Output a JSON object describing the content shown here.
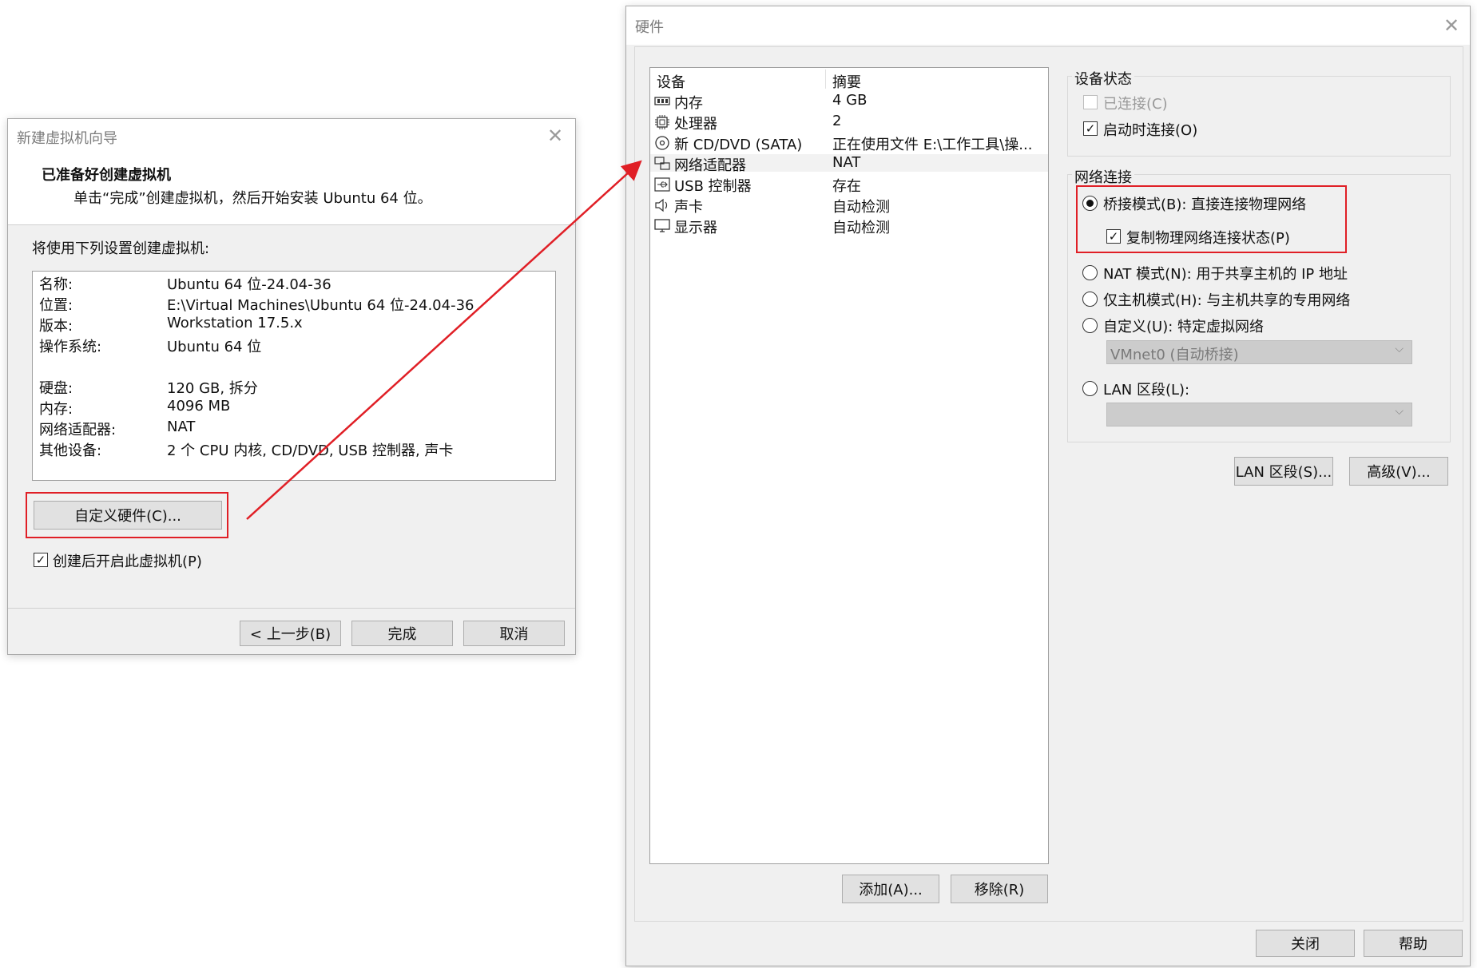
{
  "wizard": {
    "title": "新建虚拟机向导",
    "heading": "已准备好创建虚拟机",
    "subheading": "单击“完成”创建虚拟机，然后开始安装 Ubuntu 64 位。",
    "intro": "将使用下列设置创建虚拟机:",
    "settings": [
      {
        "label": "名称:",
        "value": "Ubuntu 64 位-24.04-36"
      },
      {
        "label": "位置:",
        "value": "E:\\Virtual Machines\\Ubuntu 64 位-24.04-36"
      },
      {
        "label": "版本:",
        "value": "Workstation 17.5.x"
      },
      {
        "label": "操作系统:",
        "value": "Ubuntu 64 位"
      },
      {
        "label": "硬盘:",
        "value": "120 GB, 拆分"
      },
      {
        "label": "内存:",
        "value": "4096 MB"
      },
      {
        "label": "网络适配器:",
        "value": "NAT"
      },
      {
        "label": "其他设备:",
        "value": "2 个 CPU 内核, CD/DVD, USB 控制器, 声卡"
      }
    ],
    "customize_button": "自定义硬件(C)...",
    "poweron_checkbox": "创建后开启此虚拟机(P)",
    "back_button": "< 上一步(B)",
    "finish_button": "完成",
    "cancel_button": "取消"
  },
  "hardware": {
    "title": "硬件",
    "col_device": "设备",
    "col_summary": "摘要",
    "devices": [
      {
        "icon": "memory-icon",
        "name": "内存",
        "summary": "4 GB"
      },
      {
        "icon": "cpu-icon",
        "name": "处理器",
        "summary": "2"
      },
      {
        "icon": "cd-icon",
        "name": "新 CD/DVD (SATA)",
        "summary": "正在使用文件 E:\\工作工具\\操..."
      },
      {
        "icon": "network-icon",
        "name": "网络适配器",
        "summary": "NAT"
      },
      {
        "icon": "usb-icon",
        "name": "USB 控制器",
        "summary": "存在"
      },
      {
        "icon": "speaker-icon",
        "name": "声卡",
        "summary": "自动检测"
      },
      {
        "icon": "monitor-icon",
        "name": "显示器",
        "summary": "自动检测"
      }
    ],
    "add_button": "添加(A)...",
    "remove_button": "移除(R)",
    "device_status_title": "设备状态",
    "connected": "已连接(C)",
    "connect_at_poweron": "启动时连接(O)",
    "network_title": "网络连接",
    "bridged": "桥接模式(B): 直接连接物理网络",
    "replicate": "复制物理网络连接状态(P)",
    "nat": "NAT 模式(N): 用于共享主机的 IP 地址",
    "hostonly": "仅主机模式(H): 与主机共享的专用网络",
    "custom": "自定义(U): 特定虚拟网络",
    "vmnet_value": "VMnet0 (自动桥接)",
    "lan_segment": "LAN 区段(L):",
    "lan_segments_button": "LAN 区段(S)...",
    "advanced_button": "高级(V)...",
    "close_button": "关闭",
    "help_button": "帮助",
    "accent_color": "#e01f26"
  }
}
